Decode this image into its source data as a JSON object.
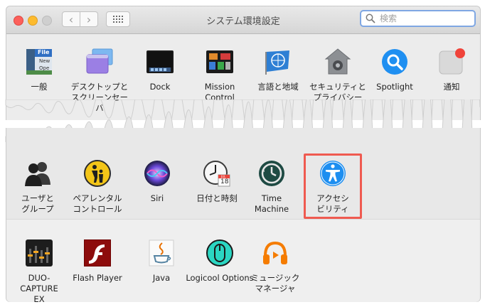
{
  "window": {
    "title": "システム環境設定",
    "search_placeholder": "検索"
  },
  "colors": {
    "accent": "#1d8ef0",
    "highlight": "#ef5a50"
  },
  "row1": [
    {
      "label": "一般",
      "icon": "general-icon"
    },
    {
      "label": "デスクトップと\nスクリーンセーバ",
      "icon": "desktop-icon"
    },
    {
      "label": "Dock",
      "icon": "dock-icon"
    },
    {
      "label": "Mission\nControl",
      "icon": "mission-control-icon"
    },
    {
      "label": "言語と地域",
      "icon": "language-region-icon"
    },
    {
      "label": "セキュリティと\nプライバシー",
      "icon": "security-icon"
    },
    {
      "label": "Spotlight",
      "icon": "spotlight-icon"
    },
    {
      "label": "通知",
      "icon": "notifications-icon"
    }
  ],
  "row2": [
    {
      "label": "ユーザと\nグループ",
      "icon": "users-icon"
    },
    {
      "label": "ペアレンタル\nコントロール",
      "icon": "parental-icon"
    },
    {
      "label": "Siri",
      "icon": "siri-icon"
    },
    {
      "label": "日付と時刻",
      "icon": "date-time-icon"
    },
    {
      "label": "Time\nMachine",
      "icon": "time-machine-icon"
    },
    {
      "label": "アクセシ\nビリティ",
      "icon": "accessibility-icon"
    }
  ],
  "row3": [
    {
      "label": "DUO-CAPTURE\nEX",
      "icon": "duo-capture-icon"
    },
    {
      "label": "Flash Player",
      "icon": "flash-icon"
    },
    {
      "label": "Java",
      "icon": "java-icon"
    },
    {
      "label": "Logicool Options",
      "icon": "logicool-icon"
    },
    {
      "label": "ミュージック\nマネージャ",
      "icon": "music-manager-icon"
    }
  ],
  "icon_text": {
    "general": "File",
    "general_line2": "New",
    "general_line3": "Ope",
    "calendar_month": "JUL",
    "calendar_day": "18"
  }
}
